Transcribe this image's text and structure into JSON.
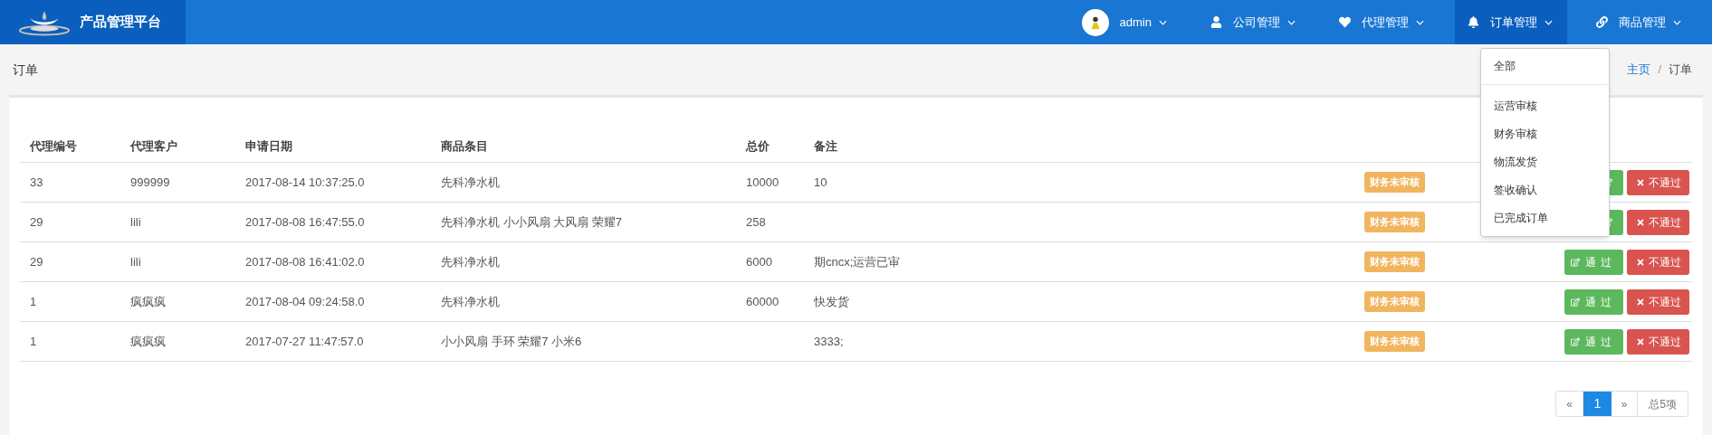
{
  "brand": "产品管理平台",
  "nav": [
    {
      "kind": "user",
      "label": "admin",
      "selected": false
    },
    {
      "kind": "user-icon",
      "label": "公司管理",
      "selected": false
    },
    {
      "kind": "heart",
      "label": "代理管理",
      "selected": false
    },
    {
      "kind": "bell",
      "label": "订单管理",
      "selected": true
    },
    {
      "kind": "link",
      "label": "商品管理",
      "selected": false
    }
  ],
  "dropdown": [
    {
      "label": "全部",
      "divider_after": true
    },
    {
      "label": "运营审核",
      "divider_after": false
    },
    {
      "label": "财务审核",
      "divider_after": false
    },
    {
      "label": "物流发货",
      "divider_after": false
    },
    {
      "label": "签收确认",
      "divider_after": false
    },
    {
      "label": "已完成订单",
      "divider_after": false
    }
  ],
  "page_title": "订单",
  "breadcrumb": [
    {
      "label": "主页",
      "link": true
    },
    {
      "label": "订单",
      "link": false
    }
  ],
  "breadcrumb_separator": "/",
  "table": {
    "columns": [
      "代理编号",
      "代理客户",
      "申请日期",
      "商品条目",
      "总价",
      "备注"
    ],
    "rows": [
      {
        "cells": [
          "33",
          "999999",
          "2017-08-14 10:37:25.0",
          "先科净水机",
          "10000",
          "10"
        ],
        "status": "财务未审核",
        "reject": "不通过"
      },
      {
        "cells": [
          "29",
          "lili",
          "2017-08-08 16:47:55.0",
          "先科净水机 小小风扇 大风扇 荣耀7",
          "258",
          ""
        ],
        "status": "财务未审核",
        "reject": "不通过"
      },
      {
        "cells": [
          "29",
          "lili",
          "2017-08-08 16:41:02.0",
          "先科净水机",
          "6000",
          "期cncx;运营已审"
        ],
        "status": "财务未审核",
        "approve": "通 过",
        "reject": "不通过"
      },
      {
        "cells": [
          "1",
          "疯疯疯",
          "2017-08-04 09:24:58.0",
          "先科净水机",
          "60000",
          "快发货"
        ],
        "status": "财务未审核",
        "approve": "通 过",
        "reject": "不通过"
      },
      {
        "cells": [
          "1",
          "疯疯疯",
          "2017-07-27 11:47:57.0",
          "小小风扇 手环 荣耀7 小米6",
          "",
          "3333;"
        ],
        "status": "财务未审核",
        "approve": "通 过",
        "reject": "不通过"
      }
    ]
  },
  "pagination": {
    "prev": "«",
    "pages": [
      {
        "label": "1",
        "selected": true
      }
    ],
    "next": "»",
    "total": "总5项"
  }
}
